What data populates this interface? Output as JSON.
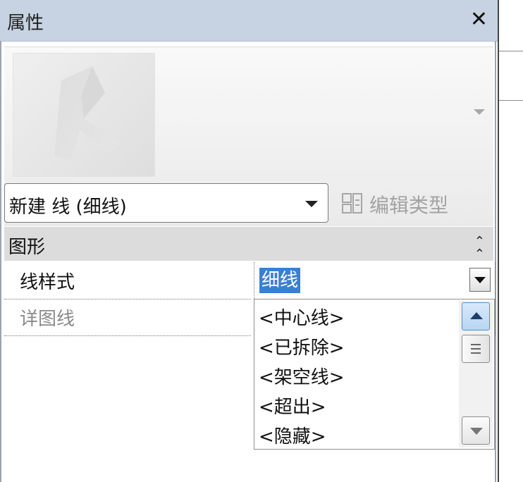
{
  "panel": {
    "title": "属性"
  },
  "type_selector": {
    "value": "新建 线 (细线)"
  },
  "edit_type": {
    "label": "编辑类型"
  },
  "section": {
    "label": "图形"
  },
  "properties": [
    {
      "name": "线样式",
      "value": "细线",
      "name_color": "#111111"
    },
    {
      "name": "详图线",
      "value": "",
      "name_color": "#8a8a8a"
    }
  ],
  "dropdown": {
    "options": [
      "<中心线>",
      "<已拆除>",
      "<架空线>",
      "<超出>",
      "<隐藏>"
    ]
  },
  "icons": {
    "close": "close-icon",
    "type_arrow": "chevron-down-icon",
    "edit_type": "edit-type-icon",
    "collapse": "double-chevron-up-icon"
  },
  "colors": {
    "title_bar": "#c7d3e2",
    "selection": "#3a7fd5",
    "section_header": "#dcdcdc"
  }
}
